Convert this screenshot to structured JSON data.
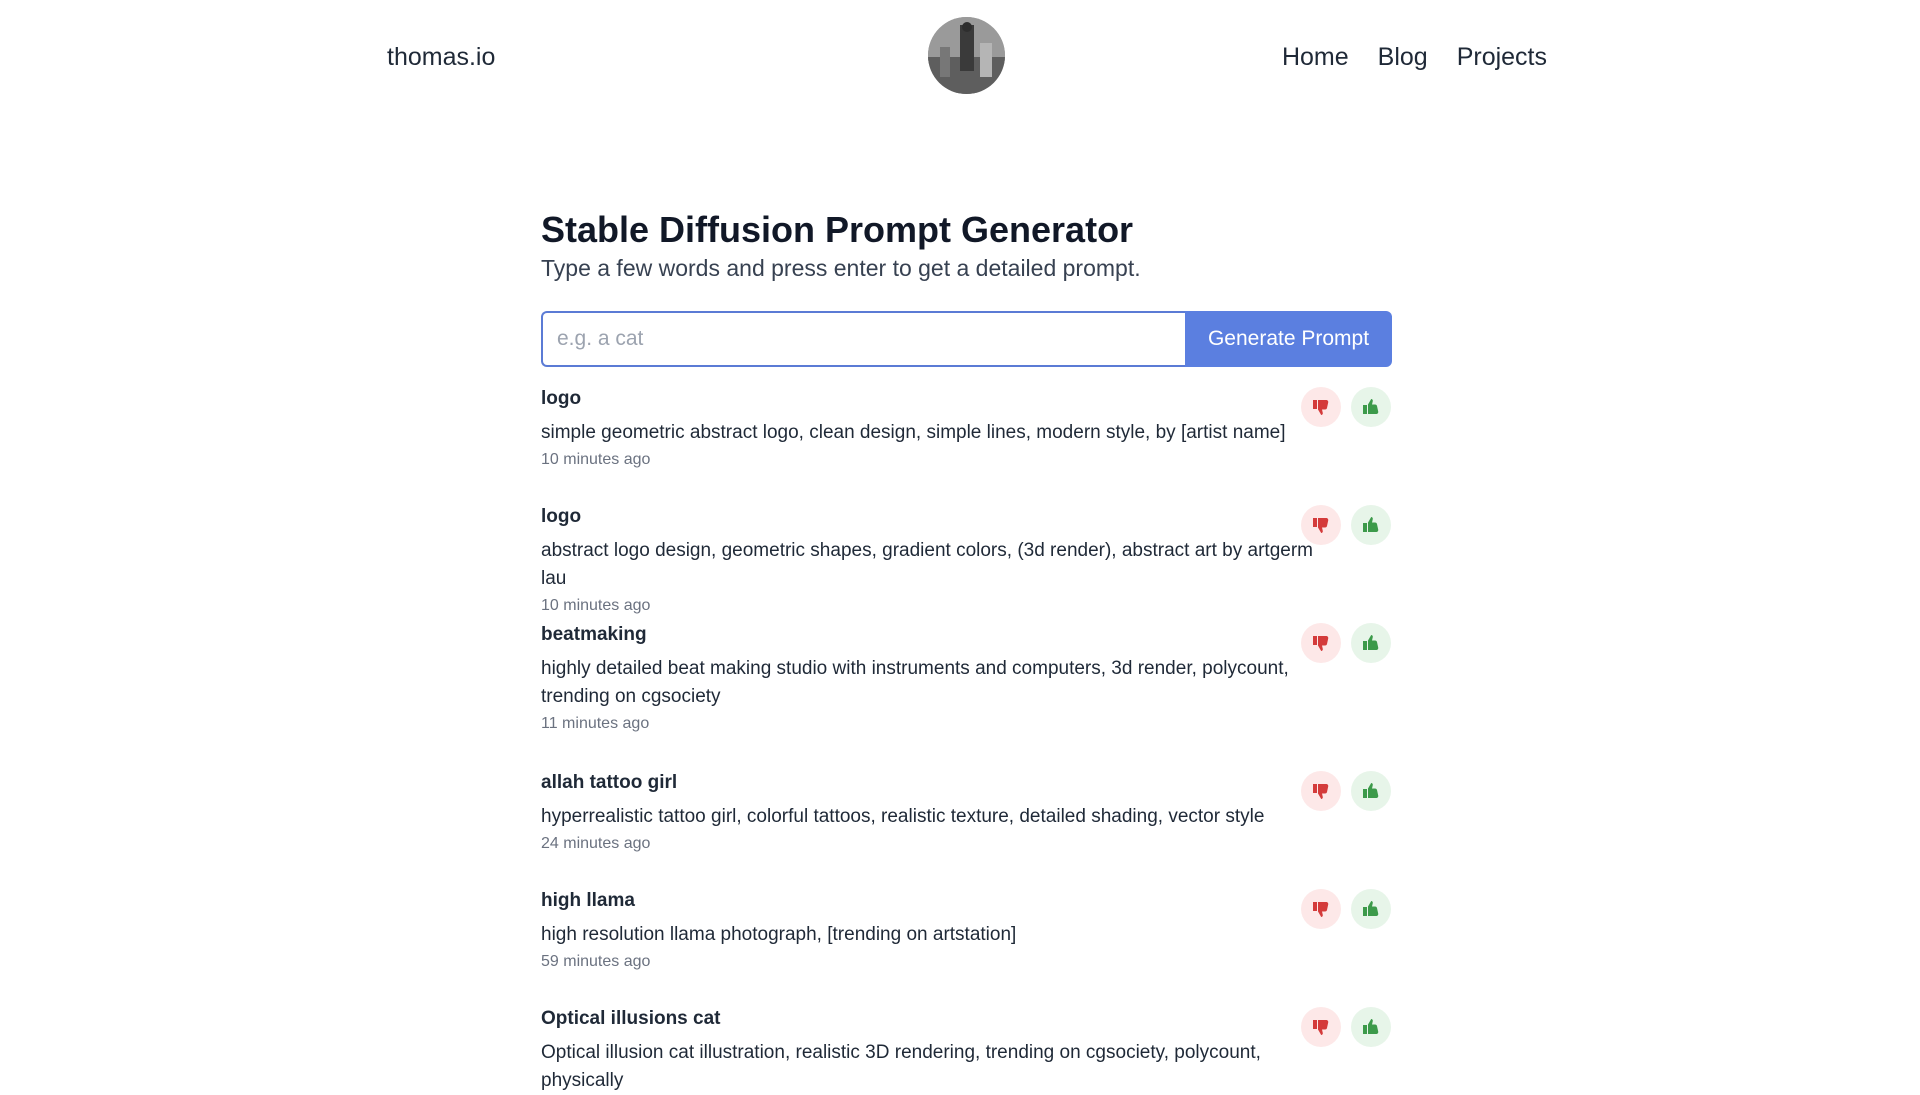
{
  "header": {
    "site_name": "thomas.io",
    "nav": [
      {
        "label": "Home"
      },
      {
        "label": "Blog"
      },
      {
        "label": "Projects"
      }
    ]
  },
  "main": {
    "title": "Stable Diffusion Prompt Generator",
    "subtitle": "Type a few words and press enter to get a detailed prompt.",
    "search": {
      "placeholder": "e.g. a cat",
      "value": "",
      "button_label": "Generate Prompt"
    },
    "prompts": [
      {
        "keyword": "logo",
        "text": "simple geometric abstract logo, clean design, simple lines, modern style, by [artist name]",
        "time": "10 minutes ago"
      },
      {
        "keyword": "logo",
        "text": "abstract logo design, geometric shapes, gradient colors, (3d render), abstract art by artgerm lau",
        "time": "10 minutes ago"
      },
      {
        "keyword": "beatmaking",
        "text": "highly detailed beat making studio with instruments and computers, 3d render, polycount, trending on cgsociety",
        "time": "11 minutes ago"
      },
      {
        "keyword": "allah tattoo girl",
        "text": "hyperrealistic tattoo girl, colorful tattoos, realistic texture, detailed shading, vector style",
        "time": "24 minutes ago"
      },
      {
        "keyword": "high llama",
        "text": "high resolution llama photograph, [trending on artstation]",
        "time": "59 minutes ago"
      },
      {
        "keyword": "Optical illusions cat",
        "text": "Optical illusion cat illustration, realistic 3D rendering, trending on cgsociety, polycount, physically",
        "time": ""
      }
    ]
  },
  "colors": {
    "accent": "#5b7fe0",
    "thumbs_down": "#d43b3b",
    "thumbs_up": "#3c9a4a"
  },
  "icons": {
    "avatar": "avatar-photo",
    "down": "thumbs-down-icon",
    "up": "thumbs-up-icon"
  }
}
